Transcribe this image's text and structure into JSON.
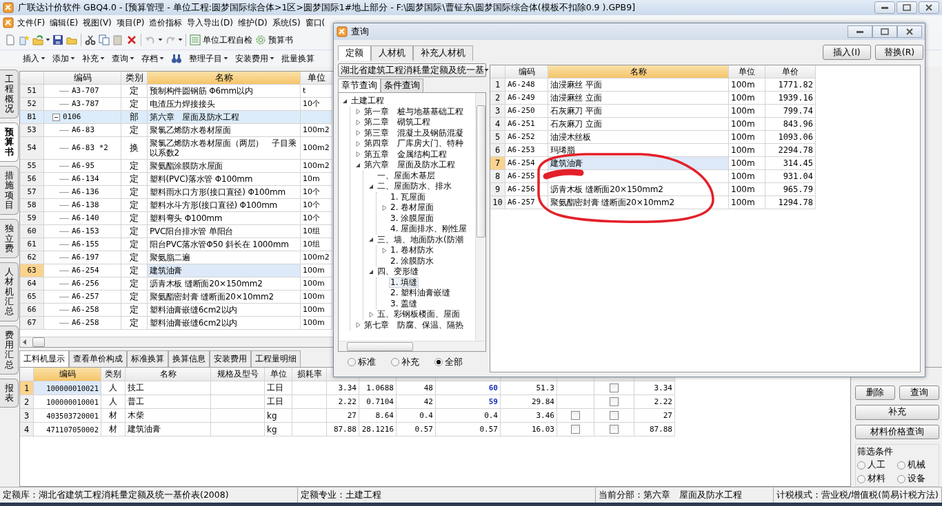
{
  "window": {
    "title": "广联达计价软件 GBQ4.0 - [预算管理 - 单位工程:圆梦国际综合体>1区>圆梦国际1#地上部分 - F:\\圆梦国际\\曹钲东\\圆梦国际综合体(模板不扣除0.9 ).GPB9]"
  },
  "menu": [
    "文件(F)",
    "编辑(E)",
    "视图(V)",
    "项目(P)",
    "造价指标",
    "导入导出(D)",
    "维护(D)",
    "系统(S)",
    "窗口("
  ],
  "toolbar": {
    "buttons": [
      "单位工程自检",
      "预算书"
    ]
  },
  "toolbar2": [
    {
      "kind": "menu",
      "label": "插入",
      "dropdown": true
    },
    {
      "kind": "menu",
      "label": "添加",
      "dropdown": true
    },
    {
      "kind": "menu",
      "label": "补充",
      "dropdown": true
    },
    {
      "kind": "menu",
      "label": "查询",
      "dropdown": true
    },
    {
      "kind": "menu",
      "label": "存档",
      "dropdown": true
    },
    {
      "kind": "icon"
    },
    {
      "kind": "menu",
      "label": "整理子目",
      "dropdown": true
    },
    {
      "kind": "menu",
      "label": "安装费用",
      "dropdown": true
    },
    {
      "kind": "menu",
      "label": "批量换算",
      "dropdown": false
    }
  ],
  "side_tabs": [
    {
      "label": "工程概况",
      "selected": false
    },
    {
      "label": "预算书",
      "selected": true
    },
    {
      "label": "措施项目",
      "selected": false
    },
    {
      "label": "独立费",
      "selected": false
    },
    {
      "label": "人材机汇总",
      "selected": false
    },
    {
      "label": "费用汇总",
      "selected": false
    },
    {
      "label": "报表",
      "selected": false
    }
  ],
  "budget_table": {
    "columns": [
      {
        "label": "编码",
        "active": false
      },
      {
        "label": "类别",
        "active": false
      },
      {
        "label": "名称",
        "active": true
      },
      {
        "label": "单位",
        "active": false
      }
    ],
    "rows": [
      {
        "kind": "item",
        "no": "51",
        "code": "A3-707",
        "type": "定",
        "name": "预制构件圆钢筋 Φ6mm以内",
        "unit": "t",
        "selected": false
      },
      {
        "kind": "item",
        "no": "52",
        "code": "A3-787",
        "type": "定",
        "name": "电渣压力焊接接头",
        "unit": "10个",
        "selected": false
      },
      {
        "kind": "section",
        "no": "B1",
        "code": "0106",
        "expanded": true,
        "type": "部",
        "name": "第六章　屋面及防水工程",
        "selected": false
      },
      {
        "kind": "item",
        "no": "53",
        "code": "A6-83",
        "type": "定",
        "name": "聚氯乙烯防水卷材屋面",
        "unit": "100m2",
        "selected": false
      },
      {
        "kind": "item",
        "no": "54",
        "code": "A6-83 *2",
        "type": "换",
        "name": "聚氯乙烯防水卷材屋面（两层）　子目乘以系数2",
        "unit": "100m2",
        "selected": false
      },
      {
        "kind": "item",
        "no": "55",
        "code": "A6-95",
        "type": "定",
        "name": "聚氨酯涂膜防水屋面",
        "unit": "100m2",
        "selected": false
      },
      {
        "kind": "item",
        "no": "56",
        "code": "A6-134",
        "type": "定",
        "name": "塑料(PVC)落水管 Φ100mm",
        "unit": "10m",
        "selected": false
      },
      {
        "kind": "item",
        "no": "57",
        "code": "A6-136",
        "type": "定",
        "name": "塑料雨水口方形(接口直径) Φ100mm",
        "unit": "10个",
        "selected": false
      },
      {
        "kind": "item",
        "no": "58",
        "code": "A6-138",
        "type": "定",
        "name": "塑料水斗方形(接口直径) Φ100mm",
        "unit": "10个",
        "selected": false
      },
      {
        "kind": "item",
        "no": "59",
        "code": "A6-140",
        "type": "定",
        "name": "塑料弯头 Φ100mm",
        "unit": "10个",
        "selected": false
      },
      {
        "kind": "item",
        "no": "60",
        "code": "A6-153",
        "type": "定",
        "name": "PVC阳台排水管 单阳台",
        "unit": "10组",
        "selected": false
      },
      {
        "kind": "item",
        "no": "61",
        "code": "A6-155",
        "type": "定",
        "name": "阳台PVC落水管Φ50 斜长在 1000mm",
        "unit": "10组",
        "selected": false
      },
      {
        "kind": "item",
        "no": "62",
        "code": "A6-197",
        "type": "定",
        "name": "聚氨脂二遍",
        "unit": "100m2",
        "selected": false
      },
      {
        "kind": "item",
        "no": "63",
        "code": "A6-254",
        "type": "定",
        "name": "建筑油膏",
        "unit": "100m",
        "selected": true
      },
      {
        "kind": "item",
        "no": "64",
        "code": "A6-256",
        "type": "定",
        "name": "沥青木板 缝断面20×150mm2",
        "unit": "100m",
        "selected": false
      },
      {
        "kind": "item",
        "no": "65",
        "code": "A6-257",
        "type": "定",
        "name": "聚氨酯密封膏 缝断面20×10mm2",
        "unit": "100m",
        "selected": false
      },
      {
        "kind": "item",
        "no": "66",
        "code": "A6-258",
        "type": "定",
        "name": "塑料油膏嵌缝6cm2以内",
        "unit": "100m",
        "selected": false
      },
      {
        "kind": "item",
        "no": "67",
        "code": "A6-258",
        "type": "定",
        "name": "塑料油膏嵌缝6cm2以内",
        "unit": "100m",
        "selected": false
      }
    ]
  },
  "detail_tabs": [
    {
      "label": "工料机显示",
      "selected": true
    },
    {
      "label": "查看单价构成",
      "selected": false
    },
    {
      "label": "标准换算",
      "selected": false
    },
    {
      "label": "换算信息",
      "selected": false
    },
    {
      "label": "安装费用",
      "selected": false
    },
    {
      "label": "工程量明细",
      "selected": false
    }
  ],
  "detail_table": {
    "columns": [
      {
        "label": "编码",
        "active": true
      },
      {
        "label": "类别",
        "active": false
      },
      {
        "label": "名称",
        "active": false
      },
      {
        "label": "规格及型号",
        "active": false
      },
      {
        "label": "单位",
        "active": false
      },
      {
        "label": "损耗率",
        "active": false
      }
    ],
    "rows": [
      {
        "no": "1",
        "code": "100000010021",
        "type": "人",
        "name": "技工",
        "unit": "工日",
        "values": [
          "3.34",
          "1.0688",
          "48",
          "60",
          "51.3"
        ],
        "column_10_marked": true,
        "column_12_box": false,
        "column_13_checked": false,
        "column_14": "3.34",
        "selected": true
      },
      {
        "no": "2",
        "code": "100000010001",
        "type": "人",
        "name": "普工",
        "unit": "工日",
        "values": [
          "2.22",
          "0.7104",
          "42",
          "59",
          "29.84"
        ],
        "column_10_marked": true,
        "column_12_box": false,
        "column_13_checked": false,
        "column_14": "2.22",
        "selected": false
      },
      {
        "no": "3",
        "code": "403503720001",
        "type": "材",
        "name": "木柴",
        "unit": "kg",
        "values": [
          "27",
          "8.64",
          "0.4",
          "0.4",
          "3.46"
        ],
        "column_10_marked": false,
        "column_12_box": true,
        "column_12_checked": false,
        "column_13_checked": false,
        "column_14": "27",
        "selected": false
      },
      {
        "no": "4",
        "code": "471107050002",
        "type": "材",
        "name": "建筑油膏",
        "unit": "kg",
        "values": [
          "87.88",
          "28.1216",
          "0.57",
          "0.57",
          "16.03"
        ],
        "column_10_marked": false,
        "column_12_box": true,
        "column_12_checked": false,
        "column_13_checked": false,
        "column_14": "87.88",
        "selected": false
      }
    ]
  },
  "side_buttons": [
    "删除",
    "查询",
    "补充",
    "材料价格查询"
  ],
  "filter_group": {
    "title": "筛选条件",
    "options": [
      {
        "label": "人工",
        "selected": false
      },
      {
        "label": "机械",
        "selected": false
      },
      {
        "label": "材料",
        "selected": false
      },
      {
        "label": "设备",
        "selected": false
      }
    ]
  },
  "status_bar": [
    "定额库：湖北省建筑工程消耗量定额及统一基价表(2008)",
    "定额专业：土建工程",
    "当前分部：第六章　屋面及防水工程",
    "计税模式：营业税/增值税(简易计税方法)"
  ],
  "query_dialog": {
    "title": "查询",
    "tabs": [
      {
        "label": "定额",
        "selected": true
      },
      {
        "label": "人材机",
        "selected": false
      },
      {
        "label": "补充人材机",
        "selected": false
      }
    ],
    "actions": [
      "插入(I)",
      "替换(R)"
    ],
    "library": "湖北省建筑工程消耗量定额及统一基",
    "subtabs": [
      {
        "label": "章节查询",
        "selected": true
      },
      {
        "label": "条件查询",
        "selected": false
      }
    ],
    "tree": [
      {
        "label": "土建工程",
        "kind": "branch",
        "expanded": true,
        "selected": false,
        "children": [
          {
            "label": "第一章　桩与地基基础工程",
            "kind": "branch",
            "expanded": false,
            "selected": false
          },
          {
            "label": "第二章　砌筑工程",
            "kind": "branch",
            "expanded": false,
            "selected": false
          },
          {
            "label": "第三章　混凝土及钢筋混凝",
            "kind": "branch",
            "expanded": false,
            "selected": false
          },
          {
            "label": "第四章　厂库房大门、特种",
            "kind": "branch",
            "expanded": false,
            "selected": false
          },
          {
            "label": "第五章　金属结构工程",
            "kind": "branch",
            "expanded": false,
            "selected": false
          },
          {
            "label": "第六章　屋面及防水工程",
            "kind": "branch",
            "expanded": true,
            "selected": false,
            "children": [
              {
                "label": "一、屋面木基层",
                "kind": "leaf",
                "selected": false
              },
              {
                "label": "二、屋面防水、排水",
                "kind": "branch",
                "expanded": true,
                "selected": false,
                "children": [
                  {
                    "label": "1. 瓦屋面",
                    "kind": "leaf",
                    "selected": false
                  },
                  {
                    "label": "2. 卷材屋面",
                    "kind": "branch",
                    "expanded": false,
                    "selected": false
                  },
                  {
                    "label": "3. 涂膜屋面",
                    "kind": "leaf",
                    "selected": false
                  },
                  {
                    "label": "4. 屋面排水、刚性屋",
                    "kind": "leaf",
                    "selected": false
                  }
                ]
              },
              {
                "label": "三、墙、地面防水(防潮",
                "kind": "branch",
                "expanded": true,
                "selected": false,
                "children": [
                  {
                    "label": "1. 卷材防水",
                    "kind": "branch",
                    "expanded": false,
                    "selected": false
                  },
                  {
                    "label": "2. 涂膜防水",
                    "kind": "leaf",
                    "selected": false
                  }
                ]
              },
              {
                "label": "四、变形缝",
                "kind": "branch",
                "expanded": true,
                "selected": false,
                "children": [
                  {
                    "label": "1. 填缝",
                    "kind": "leaf",
                    "selected": true
                  },
                  {
                    "label": "2. 塑料油膏嵌缝",
                    "kind": "leaf",
                    "selected": false
                  },
                  {
                    "label": "3. 盖缝",
                    "kind": "leaf",
                    "selected": false
                  }
                ]
              },
              {
                "label": "五、彩钢板楼面、屋面",
                "kind": "branch",
                "expanded": false,
                "selected": false
              }
            ]
          },
          {
            "label": "第七章　防腐、保温、隔热",
            "kind": "branch",
            "expanded": false,
            "selected": false
          }
        ]
      }
    ],
    "filters": [
      {
        "label": "标准",
        "selected": false
      },
      {
        "label": "补充",
        "selected": false
      },
      {
        "label": "全部",
        "selected": true
      }
    ],
    "results": {
      "columns": [
        {
          "label": "编码",
          "active": false
        },
        {
          "label": "名称",
          "active": true
        },
        {
          "label": "单位",
          "active": false
        },
        {
          "label": "单价",
          "active": false
        }
      ],
      "rows": [
        {
          "no": "1",
          "code": "A6-248",
          "name": "油浸麻丝 平面",
          "unit": "100m",
          "price": "1771.82",
          "selected": false
        },
        {
          "no": "2",
          "code": "A6-249",
          "name": "油浸麻丝 立面",
          "unit": "100m",
          "price": "1939.16",
          "selected": false
        },
        {
          "no": "3",
          "code": "A6-250",
          "name": "石灰麻刀 平面",
          "unit": "100m",
          "price": "799.74",
          "selected": false
        },
        {
          "no": "4",
          "code": "A6-251",
          "name": "石灰麻刀 立面",
          "unit": "100m",
          "price": "843.96",
          "selected": false
        },
        {
          "no": "5",
          "code": "A6-252",
          "name": "油浸木丝板",
          "unit": "100m",
          "price": "1093.06",
          "selected": false
        },
        {
          "no": "6",
          "code": "A6-253",
          "name": "玛琋脂",
          "unit": "100m",
          "price": "2294.78",
          "selected": false
        },
        {
          "no": "7",
          "code": "A6-254",
          "name": "建筑油膏",
          "unit": "100m",
          "price": "314.45",
          "selected": true
        },
        {
          "no": "8",
          "code": "A6-255",
          "unit": "100m",
          "price": "931.04",
          "selected": false
        },
        {
          "no": "9",
          "code": "A6-256",
          "name": "沥青木板 缝断面20×150mm2",
          "unit": "100m",
          "price": "965.79",
          "selected": false
        },
        {
          "no": "10",
          "code": "A6-257",
          "name": "聚氨酯密封膏 缝断面20×10mm2",
          "unit": "100m",
          "price": "1294.78",
          "selected": false
        }
      ]
    }
  }
}
